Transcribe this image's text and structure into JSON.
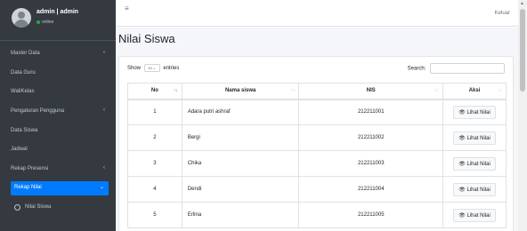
{
  "user": {
    "name": "admin | admin",
    "status": "online"
  },
  "sidebar": {
    "items": [
      {
        "label": "Master Data",
        "has_children": true
      },
      {
        "label": "Data Guru",
        "has_children": false
      },
      {
        "label": "WaliKelas",
        "has_children": false
      },
      {
        "label": "Pengaturan Pengguna",
        "has_children": true
      },
      {
        "label": "Data Siswa",
        "has_children": false
      },
      {
        "label": "Jadwal",
        "has_children": false
      },
      {
        "label": "Rekap Presensi",
        "has_children": true
      },
      {
        "label": "Rekap Nilai",
        "has_children": true,
        "active": true
      },
      {
        "label": "Nilai Siswa",
        "sub": true
      }
    ]
  },
  "topbar": {
    "logout_label": "Keluar"
  },
  "page": {
    "title": "Nilai Siswa"
  },
  "table_controls": {
    "show_label": "Show",
    "entries_value": "10",
    "entries_label": "entries",
    "search_label": "Search:"
  },
  "table": {
    "headers": [
      "No",
      "Nama siswa",
      "NIS",
      "Aksi"
    ],
    "rows": [
      {
        "no": "1",
        "name": "Adara putri ashraf",
        "nis": "212211001",
        "action": "Lihat Nilai"
      },
      {
        "no": "2",
        "name": "Bergi",
        "nis": "212211002",
        "action": "Lihat Nilai"
      },
      {
        "no": "3",
        "name": "Chika",
        "nis": "212211003",
        "action": "Lihat Nilai"
      },
      {
        "no": "4",
        "name": "Dendi",
        "nis": "212211004",
        "action": "Lihat Nilai"
      },
      {
        "no": "5",
        "name": "Erlina",
        "nis": "212211005",
        "action": "Lihat Nilai"
      }
    ]
  },
  "colors": {
    "sidebar_bg": "#343a40",
    "active": "#007bff",
    "accent": "#fce4ec"
  },
  "icons": {
    "menu": "hamburger-icon",
    "view": "eye-icon",
    "expand": "chevron-icon",
    "sort": "sort-icon"
  }
}
